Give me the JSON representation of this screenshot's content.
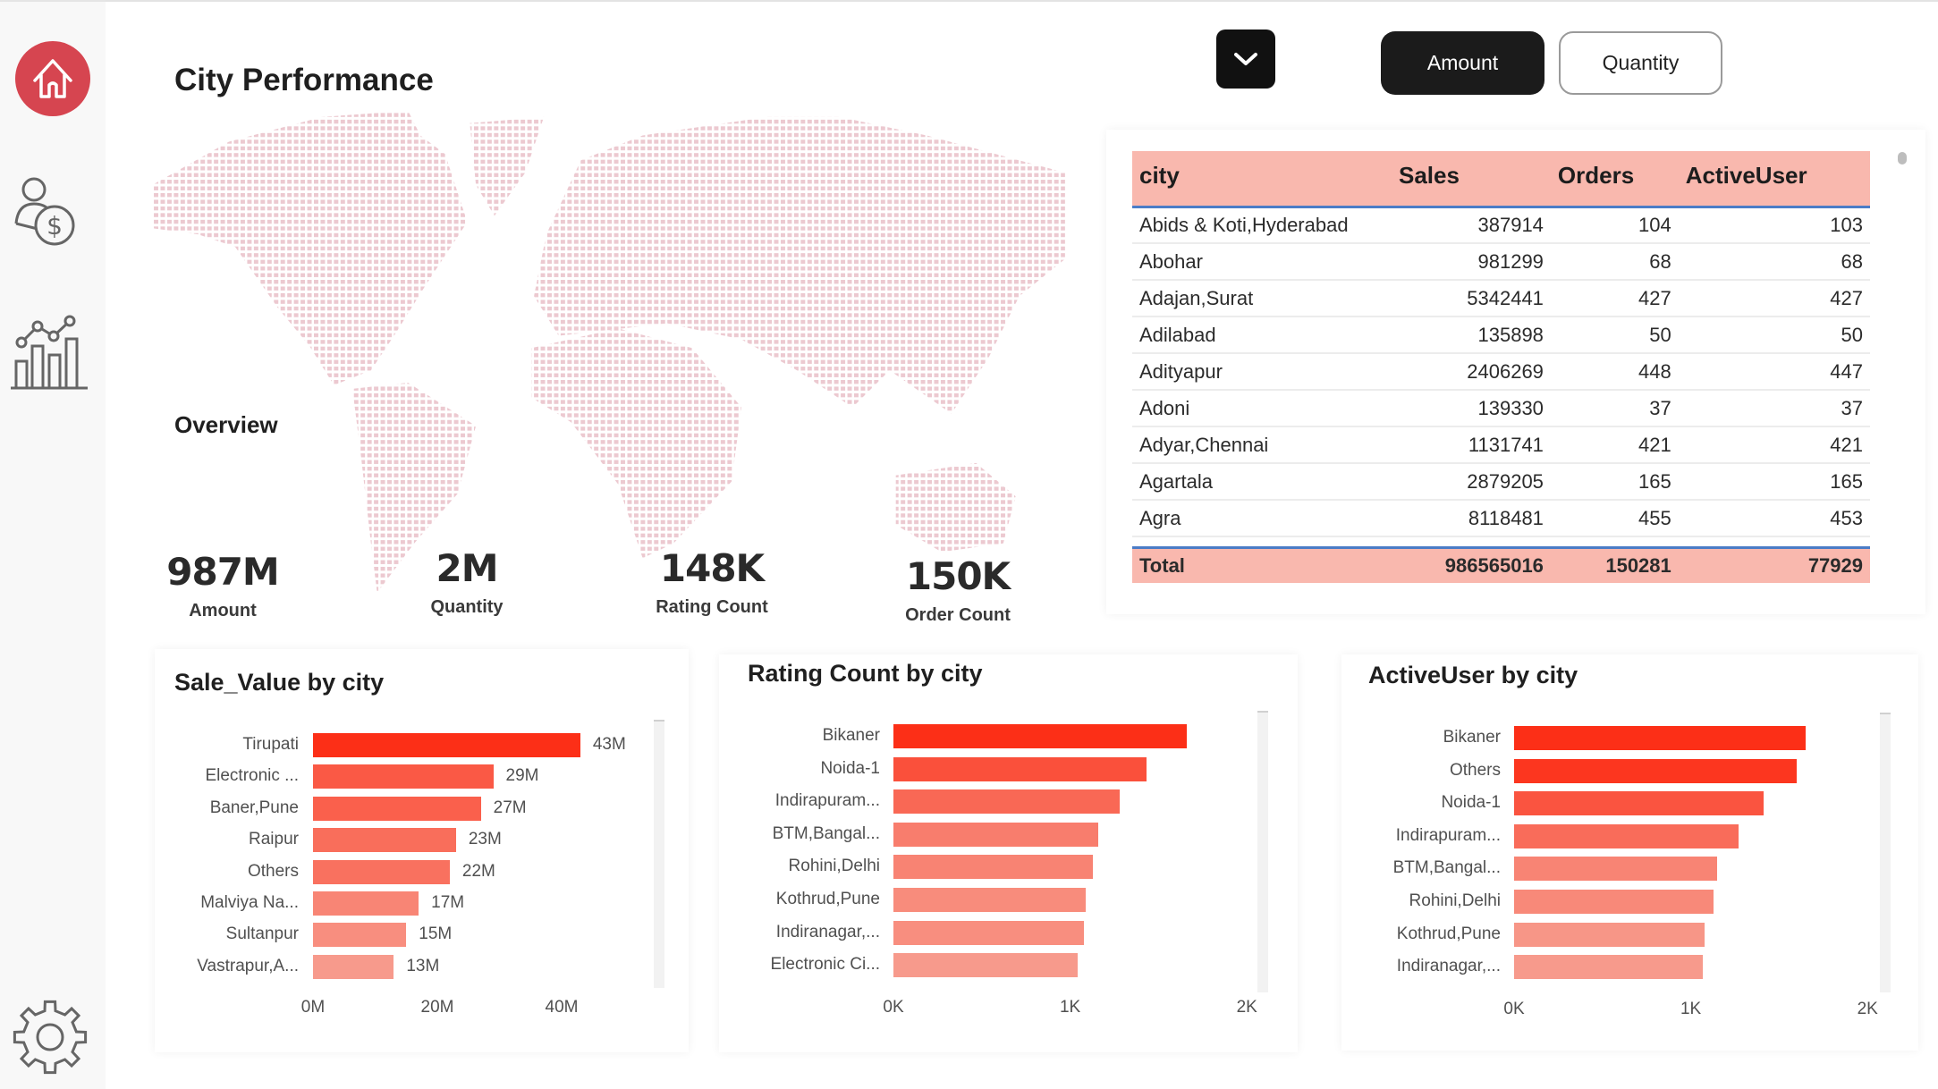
{
  "header": {
    "title": "City Performance",
    "overview": "Overview"
  },
  "sidebar": {
    "items": [
      {
        "icon": "home-icon"
      },
      {
        "icon": "user-dollar-icon"
      },
      {
        "icon": "analytics-chart-icon"
      },
      {
        "icon": "gear-icon"
      }
    ]
  },
  "kpis": [
    {
      "value": "987M",
      "label": "Amount"
    },
    {
      "value": "2M",
      "label": "Quantity"
    },
    {
      "value": "148K",
      "label": "Rating Count"
    },
    {
      "value": "150K",
      "label": "Order Count"
    }
  ],
  "toggle": {
    "amount": "Amount",
    "quantity": "Quantity",
    "active": "Amount"
  },
  "colors": {
    "accent": "#d64550",
    "bar_strong": "#fc2f17",
    "bar_light": "#f79a8c",
    "header": "#f9b8ae"
  },
  "table": {
    "headers": [
      "city",
      "Sales",
      "Orders",
      "ActiveUser"
    ],
    "rows": [
      [
        "Abids & Koti,Hyderabad",
        "387914",
        "104",
        "103"
      ],
      [
        "Abohar",
        "981299",
        "68",
        "68"
      ],
      [
        "Adajan,Surat",
        "5342441",
        "427",
        "427"
      ],
      [
        "Adilabad",
        "135898",
        "50",
        "50"
      ],
      [
        "Adityapur",
        "2406269",
        "448",
        "447"
      ],
      [
        "Adoni",
        "139330",
        "37",
        "37"
      ],
      [
        "Adyar,Chennai",
        "1131741",
        "421",
        "421"
      ],
      [
        "Agartala",
        "2879205",
        "165",
        "165"
      ],
      [
        "Agra",
        "8118481",
        "455",
        "453"
      ]
    ],
    "total": [
      "Total",
      "986565016",
      "150281",
      "77929"
    ]
  },
  "chart_data": [
    {
      "type": "bar",
      "title": "Sale_Value by city",
      "categories": [
        "Tirupati",
        "Electronic ...",
        "Baner,Pune",
        "Raipur",
        "Others",
        "Malviya Na...",
        "Sultanpur",
        "Vastrapur,A..."
      ],
      "values": [
        43,
        29,
        27,
        23,
        22,
        17,
        15,
        13
      ],
      "data_labels": [
        "43M",
        "29M",
        "27M",
        "23M",
        "22M",
        "17M",
        "15M",
        "13M"
      ],
      "xticks": [
        "0M",
        "20M",
        "40M"
      ],
      "xtick_values": [
        0,
        20,
        40
      ],
      "unit": "M",
      "xlim": [
        0,
        50
      ]
    },
    {
      "type": "bar",
      "title": "Rating Count by city",
      "categories": [
        "Bikaner",
        "Noida-1",
        "Indirapuram...",
        "BTM,Bangal...",
        "Rohini,Delhi",
        "Kothrud,Pune",
        "Indiranagar,...",
        "Electronic Ci..."
      ],
      "values": [
        1.66,
        1.43,
        1.28,
        1.16,
        1.13,
        1.09,
        1.08,
        1.04
      ],
      "xticks": [
        "0K",
        "1K",
        "2K"
      ],
      "xtick_values": [
        0,
        1,
        2
      ],
      "unit": "K",
      "xlim": [
        0,
        2
      ]
    },
    {
      "type": "bar",
      "title": "ActiveUser by city",
      "categories": [
        "Bikaner",
        "Others",
        "Noida-1",
        "Indirapuram...",
        "BTM,Bangal...",
        "Rohini,Delhi",
        "Kothrud,Pune",
        "Indiranagar,..."
      ],
      "values": [
        1.65,
        1.6,
        1.41,
        1.27,
        1.15,
        1.13,
        1.08,
        1.07
      ],
      "xticks": [
        "0K",
        "1K",
        "2K"
      ],
      "xtick_values": [
        0,
        1,
        2
      ],
      "unit": "K",
      "xlim": [
        0,
        2
      ]
    }
  ]
}
